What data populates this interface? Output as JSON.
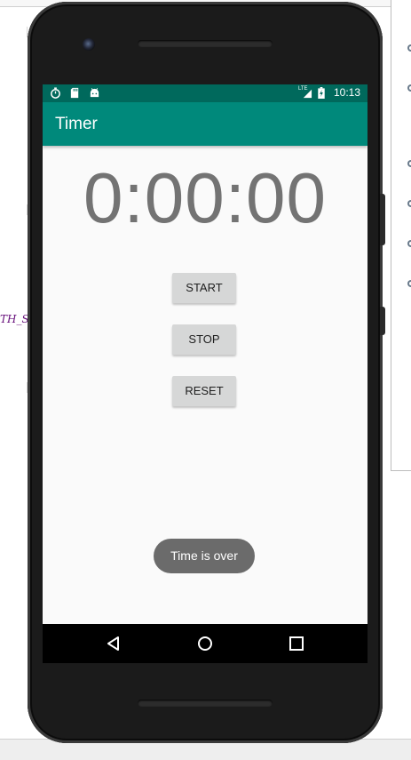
{
  "ide": {
    "code_fragment": "TH_S"
  },
  "status_bar": {
    "icons": [
      "stopwatch-icon",
      "sd-card-icon",
      "android-icon",
      "lte-signal-icon",
      "battery-charging-icon"
    ],
    "network_label": "LTE",
    "time": "10:13"
  },
  "app_bar": {
    "title": "Timer",
    "color": "#00897b",
    "status_color": "#00695c"
  },
  "timer": {
    "display": "0:00:00"
  },
  "buttons": {
    "start_label": "START",
    "stop_label": "STOP",
    "reset_label": "RESET"
  },
  "toast": {
    "message": "Time is over"
  },
  "nav_bar": {
    "icons": [
      "back-icon",
      "home-icon",
      "recents-icon"
    ]
  }
}
